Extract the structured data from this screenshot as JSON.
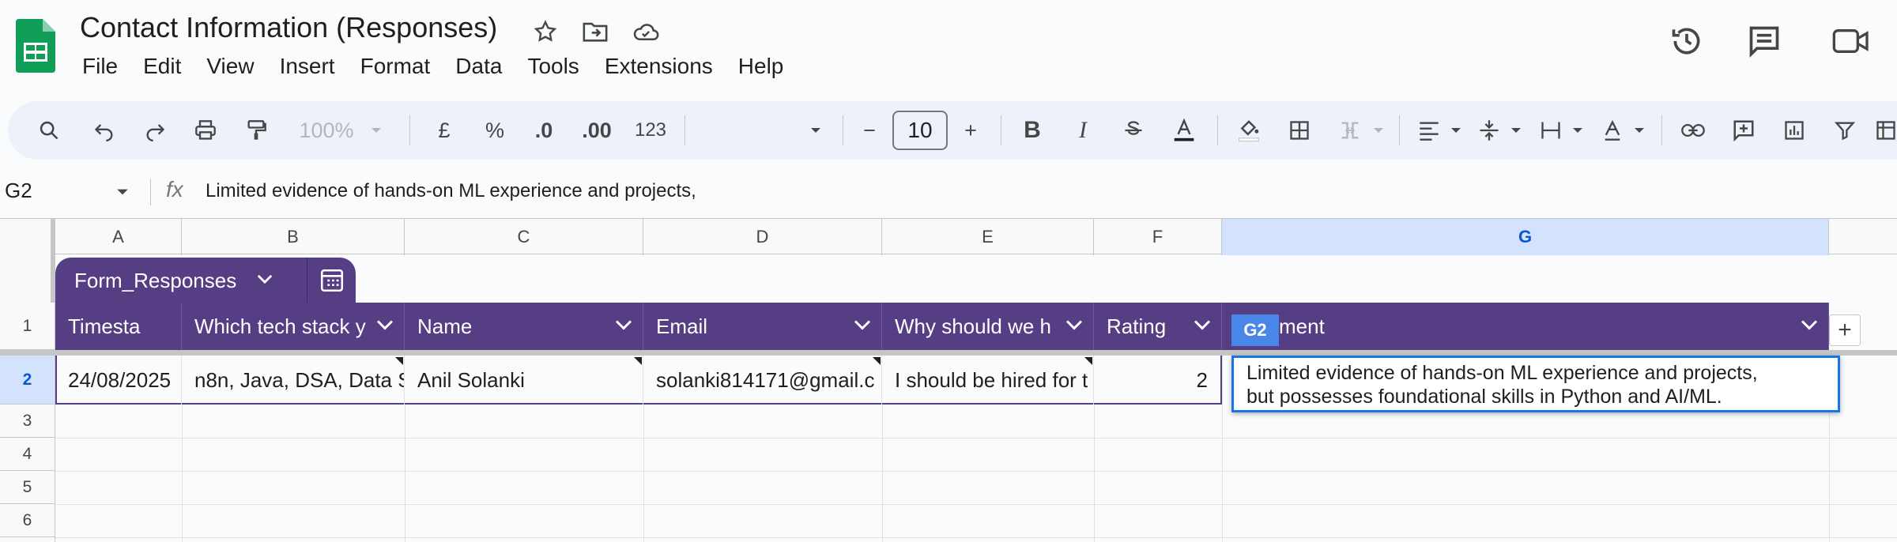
{
  "app": {
    "title": "Contact Information (Responses)",
    "menu": [
      "File",
      "Edit",
      "View",
      "Insert",
      "Format",
      "Data",
      "Tools",
      "Extensions",
      "Help"
    ]
  },
  "toolbar": {
    "zoom": "100%",
    "currency": "£",
    "percent": "%",
    "decrease_decimal": ".0",
    "increase_decimal": ".00",
    "number_format": "123",
    "font_size": "10",
    "minus": "−",
    "plus": "+",
    "bold": "B",
    "italic": "I"
  },
  "formula_bar": {
    "name_box": "G2",
    "fx": "fx",
    "content": "Limited evidence of hands-on ML experience and projects,"
  },
  "columns": [
    "A",
    "B",
    "C",
    "D",
    "E",
    "F",
    "G"
  ],
  "rows": [
    "1",
    "2",
    "3",
    "4",
    "5",
    "6"
  ],
  "table": {
    "name": "Form_Responses",
    "headers": [
      "Timesta",
      "Which tech stack y",
      "Name",
      "Email",
      "Why should we h",
      "Rating",
      "ment"
    ],
    "row2": {
      "A": "24/08/2025",
      "B": "n8n, Java, DSA, Data S",
      "C": "Anil Solanki",
      "D": "solanki814171@gmail.c",
      "E": "I should be hired for t",
      "F": "2"
    }
  },
  "selection": {
    "tag": "G2",
    "editor_text": "Limited evidence of hands-on ML experience and projects,\nbut possesses foundational skills in Python and AI/ML."
  },
  "colors": {
    "table_header": "#553e84",
    "selection": "#1a73e8",
    "sheets_green": "#0f9d58"
  }
}
